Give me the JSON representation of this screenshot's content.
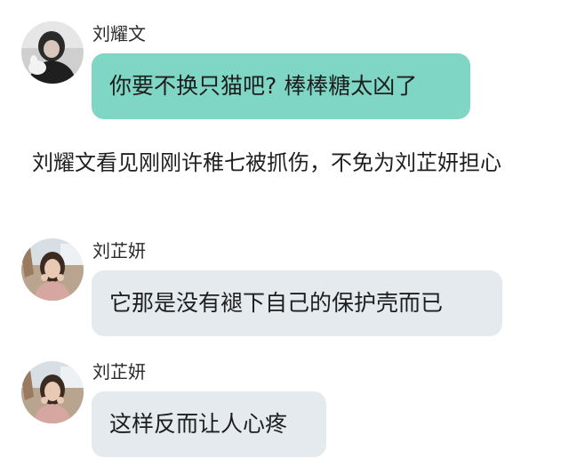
{
  "messages": [
    {
      "sender": "刘耀文",
      "text": "你要不换只猫吧? 棒棒糖太凶了",
      "bubble_color": "#7fd6c4",
      "avatar_icon": "avatar-photo-dark"
    },
    {
      "sender": "刘芷妍",
      "text": "它那是没有褪下自己的保护壳而已",
      "bubble_color": "#e4eaee",
      "avatar_icon": "avatar-photo-girl"
    },
    {
      "sender": "刘芷妍",
      "text": "这样反而让人心疼",
      "bubble_color": "#e4eaee",
      "avatar_icon": "avatar-photo-girl"
    }
  ],
  "narration": "刘耀文看见刚刚许稚七被抓伤，不免为刘芷妍担心"
}
